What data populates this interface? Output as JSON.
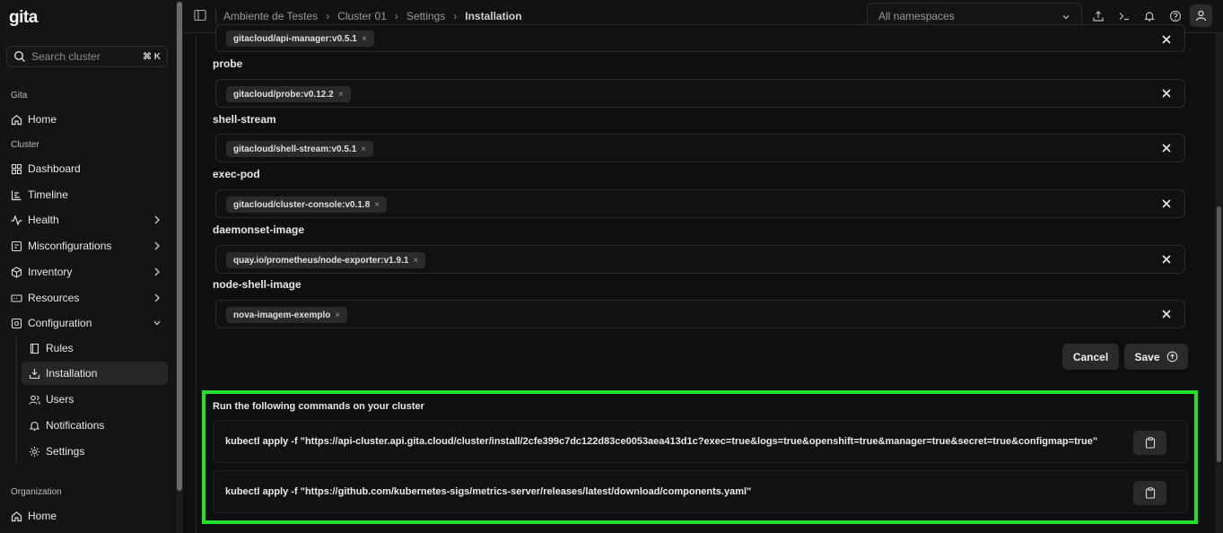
{
  "app": {
    "logo": "gita"
  },
  "search": {
    "placeholder": "Search cluster",
    "shortcut": "⌘ K"
  },
  "sidebar": {
    "section_gita": "Gita",
    "home": "Home",
    "section_cluster": "Cluster",
    "cluster_items": [
      {
        "label": "Dashboard",
        "icon": "grid-icon"
      },
      {
        "label": "Timeline",
        "icon": "timeline-icon"
      },
      {
        "label": "Health",
        "icon": "pulse-icon"
      },
      {
        "label": "Misconfigurations",
        "icon": "misconfig-icon"
      },
      {
        "label": "Inventory",
        "icon": "cube-icon"
      },
      {
        "label": "Resources",
        "icon": "resources-icon"
      },
      {
        "label": "Configuration",
        "icon": "config-icon"
      }
    ],
    "config_items": [
      {
        "label": "Rules",
        "icon": "book-icon"
      },
      {
        "label": "Installation",
        "icon": "download-icon",
        "active": true
      },
      {
        "label": "Users",
        "icon": "users-icon"
      },
      {
        "label": "Notifications",
        "icon": "bell-icon"
      },
      {
        "label": "Settings",
        "icon": "gear-icon"
      }
    ],
    "section_org": "Organization",
    "org_home": "Home"
  },
  "breadcrumb": [
    "Ambiente de Testes",
    "Cluster 01",
    "Settings",
    "Installation"
  ],
  "namespace_select": {
    "value": "All namespaces"
  },
  "fields": [
    {
      "label": "",
      "chip": "gitacloud/api-manager:v0.5.1"
    },
    {
      "label": "probe",
      "chip": "gitacloud/probe:v0.12.2"
    },
    {
      "label": "shell-stream",
      "chip": "gitacloud/shell-stream:v0.5.1"
    },
    {
      "label": "exec-pod",
      "chip": "gitacloud/cluster-console:v0.1.8"
    },
    {
      "label": "daemonset-image",
      "chip": "quay.io/prometheus/node-exporter:v1.9.1"
    },
    {
      "label": "node-shell-image",
      "chip": "nova-imagem-exemplo"
    }
  ],
  "chip_remove": "×",
  "buttons": {
    "cancel": "Cancel",
    "save": "Save"
  },
  "commands": {
    "title": "Run the following commands on your cluster",
    "items": [
      "kubectl apply -f \"https://api-cluster.api.gita.cloud/cluster/install/2cfe399c7dc122d83ce0053aea413d1c?exec=true&logs=true&openshift=true&manager=true&secret=true&configmap=true\"",
      "kubectl apply -f \"https://github.com/kubernetes-sigs/metrics-server/releases/latest/download/components.yaml\""
    ]
  },
  "colors": {
    "highlight": "#22e02a",
    "background": "#0f0f0f",
    "chip": "#2a2a2a"
  }
}
